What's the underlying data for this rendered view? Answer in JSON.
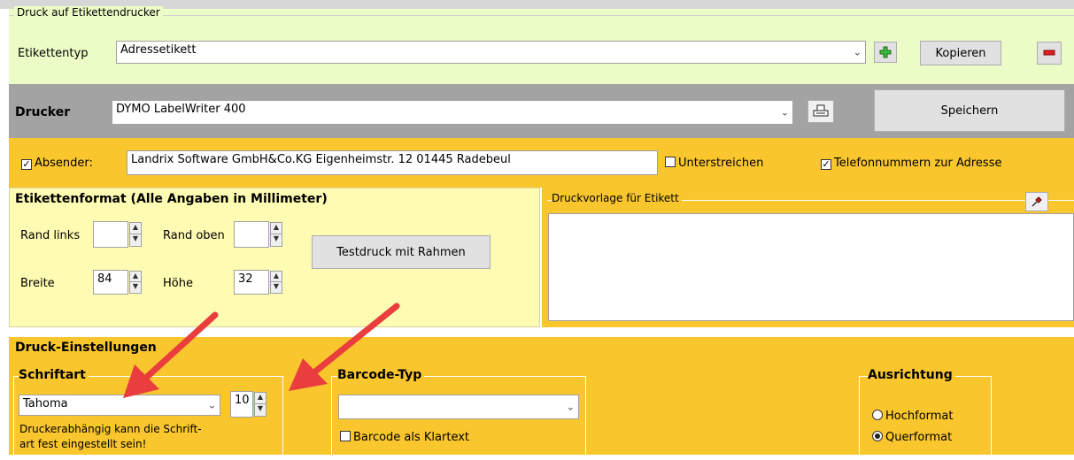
{
  "window": {
    "title": "Druck auf Etikettendrucker"
  },
  "etikettentyp": {
    "label": "Etikettentyp",
    "value": "Adressetikett",
    "copy_label": "Kopieren"
  },
  "drucker": {
    "label": "Drucker",
    "value": "DYMO LabelWriter 400",
    "save_label": "Speichern"
  },
  "absender": {
    "label": "Absender:",
    "checked": true,
    "value": "Landrix Software GmbH&Co.KG Eigenheimstr. 12 01445 Radebeul",
    "underline_label": "Unterstreichen",
    "phone_label": "Telefonnummern zur Adresse"
  },
  "format": {
    "title": "Etikettenformat (Alle Angaben in Millimeter)",
    "rand_links_label": "Rand links",
    "rand_links_value": "",
    "rand_oben_label": "Rand oben",
    "rand_oben_value": "",
    "breite_label": "Breite",
    "breite_value": "84",
    "hoehe_label": "Höhe",
    "hoehe_value": "32",
    "test_label": "Testdruck mit Rahmen"
  },
  "vorlage": {
    "title": "Druckvorlage für Etikett"
  },
  "settings": {
    "title": "Druck-Einstellungen",
    "schriftart_title": "Schriftart",
    "font_value": "Tahoma",
    "size_value": "10",
    "note_line1": "Druckerabhängig kann die Schrift-",
    "note_line2": "art fest eingestellt sein!",
    "barcode_title": "Barcode-Typ",
    "barcode_value": "",
    "barcode_text_label": "Barcode als Klartext",
    "ausrichtung_title": "Ausrichtung",
    "hoch_label": "Hochformat",
    "quer_label": "Querformat"
  },
  "colors": {
    "light_green": "#ecfcc6",
    "gray": "#a3a3a3",
    "orange": "#f9c62e",
    "light_yellow": "#fefbb2",
    "annotation_red": "#ea3d3d"
  }
}
